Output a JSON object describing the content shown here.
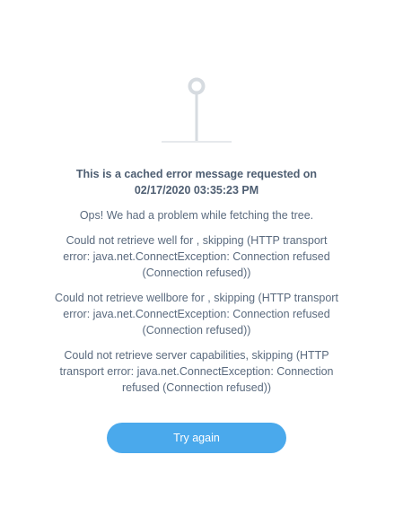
{
  "error": {
    "illustration_icon": "pin-icon",
    "cached_title_line1": "This is a cached error message requested on",
    "cached_title_line2": "02/17/2020 03:35:23 PM",
    "fetch_problem": "Ops! We had a problem while fetching the tree.",
    "messages": [
      "Could not retrieve well for , skipping (HTTP transport error: java.net.ConnectException: Connection refused (Connection refused))",
      "Could not retrieve wellbore for , skipping (HTTP transport error: java.net.ConnectException: Connection refused (Connection refused))",
      "Could not retrieve server capabilities, skipping (HTTP transport error: java.net.ConnectException: Connection refused (Connection refused))"
    ]
  },
  "actions": {
    "try_again_label": "Try again"
  },
  "colors": {
    "button_background": "#4aa9ec",
    "text": "#5a6a7e",
    "illustration": "#d6dbe0"
  }
}
